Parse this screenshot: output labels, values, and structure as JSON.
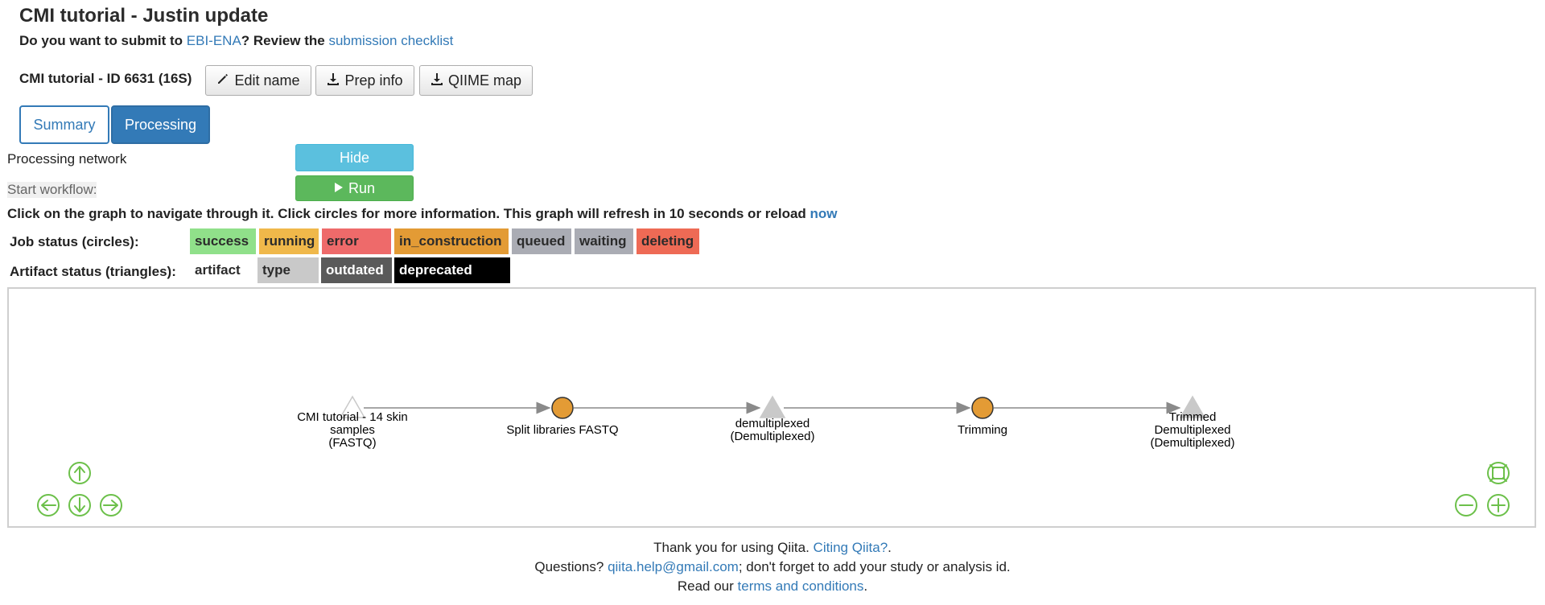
{
  "header": {
    "title": "CMI tutorial - Justin update",
    "submit_prefix": "Do you want to submit to ",
    "submit_link": "EBI-ENA",
    "submit_mid": "? Review the ",
    "checklist_link": "submission checklist"
  },
  "prep": {
    "id_label": "CMI tutorial - ID 6631 (16S)",
    "edit_name": "Edit name",
    "prep_info": "Prep info",
    "qiime_map": "QIIME map"
  },
  "tabs": {
    "summary": "Summary",
    "processing": "Processing"
  },
  "processing": {
    "network_label": "Processing network",
    "hide_label": "Hide",
    "workflow_label": "Start workflow:",
    "run_label": "Run",
    "instructions": "Click on the graph to navigate through it. Click circles for more information. This graph will refresh in 10 seconds or reload ",
    "now_link": "now"
  },
  "legend": {
    "job_label": "Job status (circles):",
    "job_statuses": [
      {
        "label": "success",
        "color": "#90e08a"
      },
      {
        "label": "running",
        "color": "#f0b84a"
      },
      {
        "label": "error",
        "color": "#ee6a6a"
      },
      {
        "label": "in_construction",
        "color": "#e39b35"
      },
      {
        "label": "queued",
        "color": "#aaacb4"
      },
      {
        "label": "waiting",
        "color": "#aaacb4"
      },
      {
        "label": "deleting",
        "color": "#ee6a55"
      }
    ],
    "artifact_label": "Artifact status (triangles):",
    "artifact_statuses": [
      {
        "label": "artifact",
        "color": "#ffffff"
      },
      {
        "label": "type",
        "color": "#c9c9c9"
      },
      {
        "label": "outdated",
        "color": "#5a5a5a"
      },
      {
        "label": "deprecated",
        "color": "#000000"
      }
    ]
  },
  "graph": {
    "nodes": [
      {
        "kind": "artifact",
        "lines": [
          "CMI tutorial - 14 skin",
          "samples",
          "(FASTQ)"
        ]
      },
      {
        "kind": "job",
        "lines": [
          "Split libraries FASTQ"
        ]
      },
      {
        "kind": "artifact",
        "lines": [
          "demultiplexed",
          "(Demultiplexed)"
        ]
      },
      {
        "kind": "job",
        "lines": [
          "Trimming"
        ]
      },
      {
        "kind": "artifact",
        "lines": [
          "Trimmed",
          "Demultiplexed",
          "(Demultiplexed)"
        ]
      }
    ],
    "colors": {
      "job": "#e39b35",
      "artifact_outline": "#c9c9c9",
      "nav": "#6cc04a"
    }
  },
  "footer": {
    "thanks": "Thank you for using Qiita. ",
    "citing_link": "Citing Qiita?",
    "thanks_end": ".",
    "questions": "Questions? ",
    "email_link": "qiita.help@gmail.com",
    "questions_end": "; don't forget to add your study or analysis id.",
    "read": "Read our ",
    "terms_link": "terms and conditions",
    "read_end": "."
  }
}
